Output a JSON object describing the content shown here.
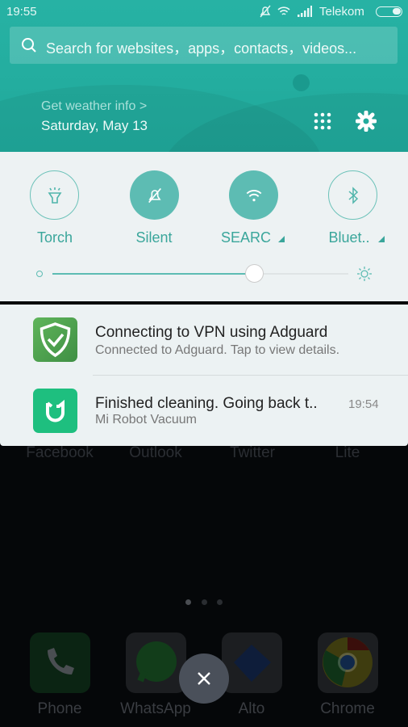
{
  "status_bar": {
    "time": "19:55",
    "carrier": "Telekom",
    "icons": [
      "silent-icon",
      "wifi-icon",
      "signal-icon",
      "battery-icon"
    ]
  },
  "search": {
    "placeholder": "Search for websites，apps，contacts，videos..."
  },
  "weather": {
    "link": "Get weather info >",
    "date": "Saturday, May 13"
  },
  "quick_settings": {
    "toggles": [
      {
        "label": "Torch",
        "icon": "torch-icon",
        "active": false
      },
      {
        "label": "Silent",
        "icon": "silent-icon",
        "active": true
      },
      {
        "label": "SEARC",
        "icon": "wifi-icon",
        "active": true
      },
      {
        "label": "Bluet..",
        "icon": "bluetooth-icon",
        "active": false
      }
    ],
    "brightness": 0.68
  },
  "notifications": [
    {
      "app": "Adguard",
      "title": "Connecting to VPN using Adguard",
      "text": "Connected to Adguard. Tap to view details.",
      "time": ""
    },
    {
      "app": "Mi Home",
      "title": "Finished cleaning. Going back t..",
      "text": "Mi Robot Vacuum",
      "time": "19:54"
    }
  ],
  "home": {
    "faded_labels": [
      "Facebook",
      "Outlook",
      "Twitter",
      "Lite"
    ],
    "dock": [
      {
        "label": "Phone"
      },
      {
        "label": "WhatsApp"
      },
      {
        "label": "Alto"
      },
      {
        "label": "Chrome"
      }
    ],
    "page_count": 3,
    "current_page": 1
  },
  "colors": {
    "accent": "#25b0a2",
    "panel": "#edf2f3"
  }
}
